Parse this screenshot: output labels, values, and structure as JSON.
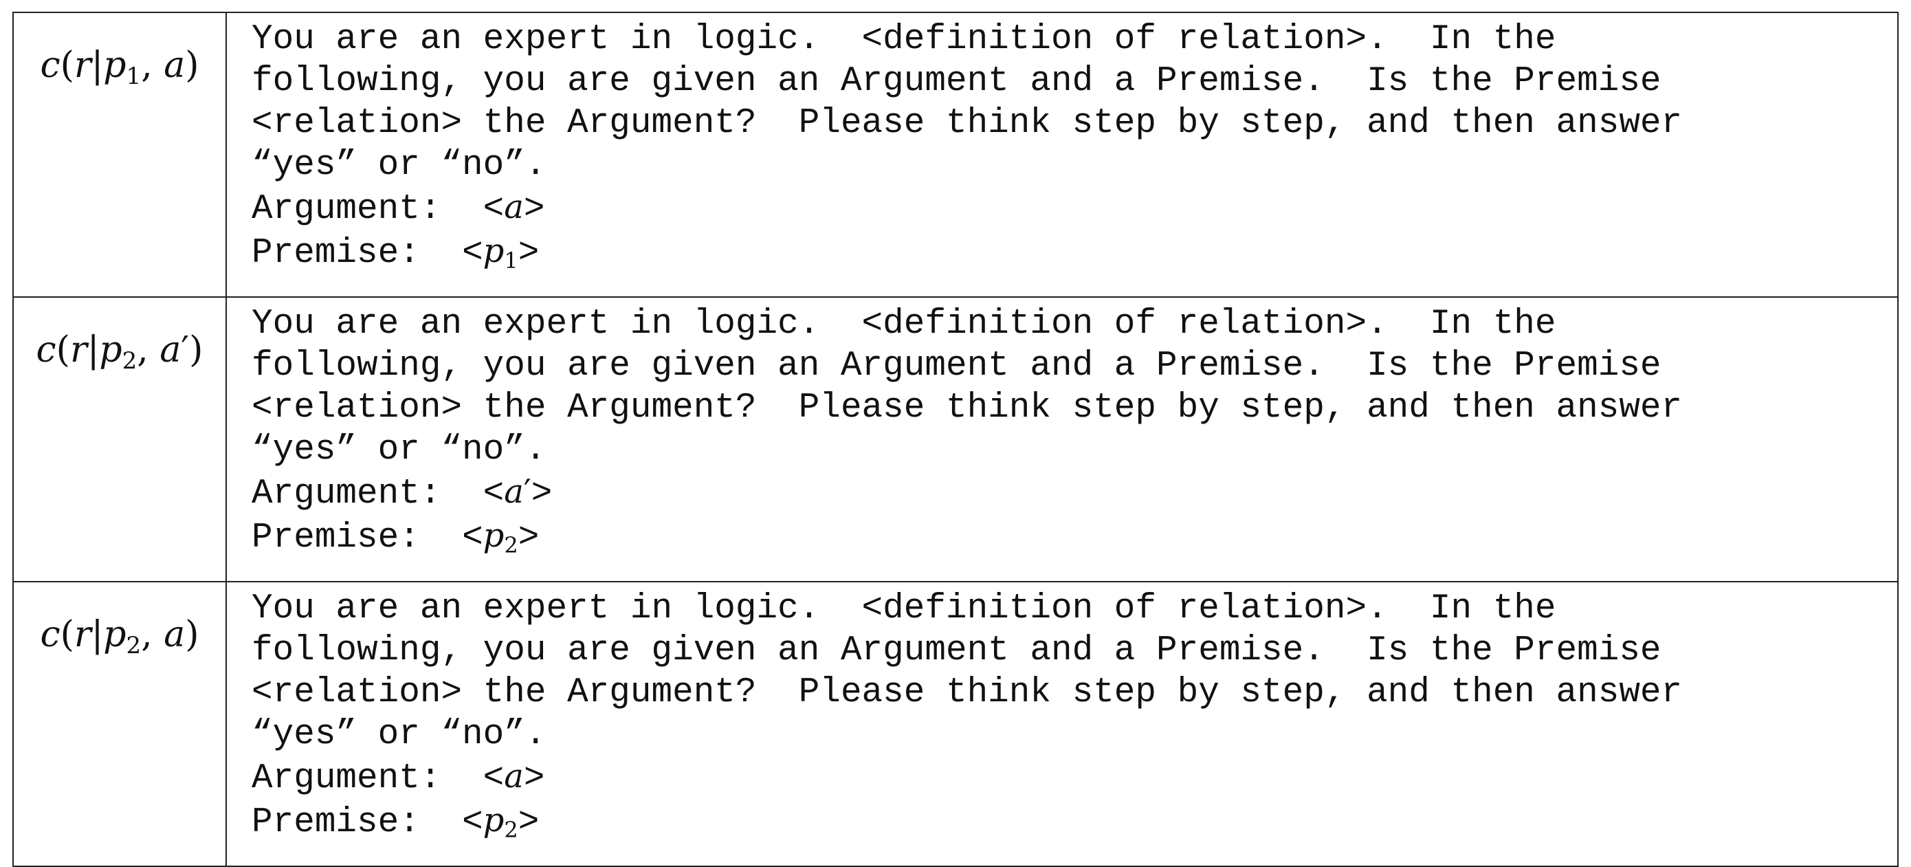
{
  "rows": [
    {
      "label": {
        "fn": "c",
        "rel": "r",
        "premise_var": "p",
        "premise_idx": "1",
        "arg": "a",
        "arg_prime": ""
      },
      "lines": [
        "You are an expert in logic.  <definition of relation>.  In the",
        "following, you are given an Argument and a Premise.  Is the Premise",
        "<relation> the Argument?  Please think step by step, and then answer",
        "“yes” or “no”."
      ],
      "argument_prefix": "Argument:  ",
      "argument_var": "a",
      "argument_prime": "",
      "premise_prefix": "Premise:  ",
      "premise_var": "p",
      "premise_idx": "1"
    },
    {
      "label": {
        "fn": "c",
        "rel": "r",
        "premise_var": "p",
        "premise_idx": "2",
        "arg": "a",
        "arg_prime": "′"
      },
      "lines": [
        "You are an expert in logic.  <definition of relation>.  In the",
        "following, you are given an Argument and a Premise.  Is the Premise",
        "<relation> the Argument?  Please think step by step, and then answer",
        "“yes” or “no”."
      ],
      "argument_prefix": "Argument:  ",
      "argument_var": "a",
      "argument_prime": "′",
      "premise_prefix": "Premise:  ",
      "premise_var": "p",
      "premise_idx": "2"
    },
    {
      "label": {
        "fn": "c",
        "rel": "r",
        "premise_var": "p",
        "premise_idx": "2",
        "arg": "a",
        "arg_prime": ""
      },
      "lines": [
        "You are an expert in logic.  <definition of relation>.  In the",
        "following, you are given an Argument and a Premise.  Is the Premise",
        "<relation> the Argument?  Please think step by step, and then answer",
        "“yes” or “no”."
      ],
      "argument_prefix": "Argument:  ",
      "argument_var": "a",
      "argument_prime": "",
      "premise_prefix": "Premise:  ",
      "premise_var": "p",
      "premise_idx": "2"
    }
  ],
  "symbols": {
    "open_paren": "(",
    "close_paren": ")",
    "bar": "|",
    "comma": ", ",
    "lt": "<",
    "gt": ">"
  }
}
